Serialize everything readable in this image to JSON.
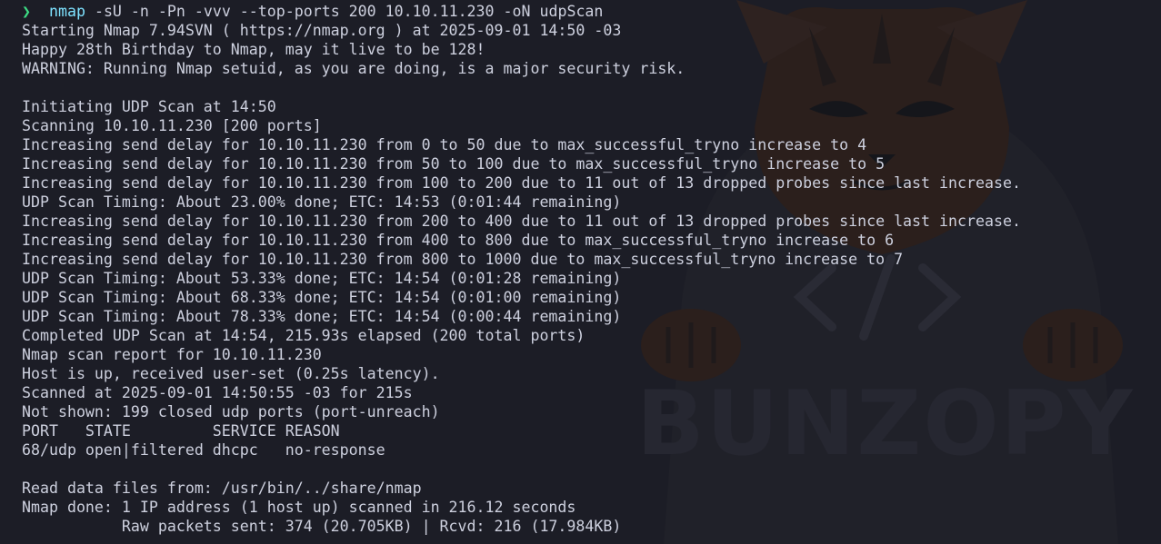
{
  "prompt": {
    "symbol": "❯",
    "command": "nmap",
    "args": "-sU -n -Pn -vvv --top-ports 200 10.10.11.230 -oN udpScan"
  },
  "watermark": {
    "text": "BUNZOPY"
  },
  "output_lines": [
    "Starting Nmap 7.94SVN ( https://nmap.org ) at 2025-09-01 14:50 -03",
    "Happy 28th Birthday to Nmap, may it live to be 128!",
    "WARNING: Running Nmap setuid, as you are doing, is a major security risk.",
    "",
    "Initiating UDP Scan at 14:50",
    "Scanning 10.10.11.230 [200 ports]",
    "Increasing send delay for 10.10.11.230 from 0 to 50 due to max_successful_tryno increase to 4",
    "Increasing send delay for 10.10.11.230 from 50 to 100 due to max_successful_tryno increase to 5",
    "Increasing send delay for 10.10.11.230 from 100 to 200 due to 11 out of 13 dropped probes since last increase.",
    "UDP Scan Timing: About 23.00% done; ETC: 14:53 (0:01:44 remaining)",
    "Increasing send delay for 10.10.11.230 from 200 to 400 due to 11 out of 13 dropped probes since last increase.",
    "Increasing send delay for 10.10.11.230 from 400 to 800 due to max_successful_tryno increase to 6",
    "Increasing send delay for 10.10.11.230 from 800 to 1000 due to max_successful_tryno increase to 7",
    "UDP Scan Timing: About 53.33% done; ETC: 14:54 (0:01:28 remaining)",
    "UDP Scan Timing: About 68.33% done; ETC: 14:54 (0:01:00 remaining)",
    "UDP Scan Timing: About 78.33% done; ETC: 14:54 (0:00:44 remaining)",
    "Completed UDP Scan at 14:54, 215.93s elapsed (200 total ports)",
    "Nmap scan report for 10.10.11.230",
    "Host is up, received user-set (0.25s latency).",
    "Scanned at 2025-09-01 14:50:55 -03 for 215s",
    "Not shown: 199 closed udp ports (port-unreach)",
    "PORT   STATE         SERVICE REASON",
    "68/udp open|filtered dhcpc   no-response",
    "",
    "Read data files from: /usr/bin/../share/nmap",
    "Nmap done: 1 IP address (1 host up) scanned in 216.12 seconds",
    "           Raw packets sent: 374 (20.705KB) | Rcvd: 216 (17.984KB)"
  ]
}
